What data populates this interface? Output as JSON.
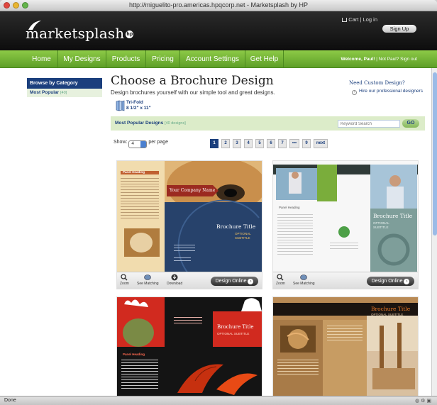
{
  "window": {
    "title": "http://miguelito-pro.americas.hpqcorp.net - Marketsplash by HP"
  },
  "header": {
    "logo_text": "marketsplash",
    "hp_badge": "hp",
    "toplinks": "Cart | Log in",
    "signup_label": "Sign Up"
  },
  "nav": {
    "items": [
      "Home",
      "My Designs",
      "Products",
      "Pricing",
      "Account Settings",
      "Get Help"
    ],
    "welcome": "Welcome, Paul!",
    "not_paul": "Not Paul?",
    "sign_out": "Sign out"
  },
  "sidebar": {
    "heading": "Browse by Category",
    "item_label": "Most Popular",
    "item_count": "[40]"
  },
  "main": {
    "title": "Choose a Brochure Design",
    "subtitle": "Design brochures yourself with our simple tool and great designs.",
    "custom_title": "Need Custom Design?",
    "custom_link": "Hire our professional designers",
    "fold_name": "Tri-Fold",
    "fold_size": "8 1/2\" x 11\""
  },
  "popular": {
    "label": "Most Popular Designs",
    "count": "[40 designs]",
    "search_placeholder": "Keyword Search",
    "go_label": "GO"
  },
  "paging": {
    "show_label": "Show:",
    "per_page_value": "4",
    "per_page_label": "per page",
    "pages": [
      "1",
      "2",
      "3",
      "4",
      "5",
      "6",
      "7",
      "•••",
      "9",
      "next"
    ],
    "active_page": "1"
  },
  "cards": [
    {
      "panel_heading": "Panel Heading",
      "company": "Your Company Name",
      "brochure_title": "Brochure Title",
      "optional": "OPTIONAL",
      "subtitle": "SUBTITLE",
      "zoom": "Zoom",
      "see_matching": "See Matching",
      "download": "Download",
      "design_online": "Design Online"
    },
    {
      "panel_heading": "Panel Heading",
      "brochure_title": "Brochure Title",
      "optional": "OPTIONAL",
      "subtitle": "SUBTITLE",
      "zoom": "Zoom",
      "see_matching": "See Matching",
      "design_online": "Design Online"
    },
    {
      "brochure_title": "Brochure Title",
      "optional": "OPTIONAL SUBTITLE",
      "panel_heading": "Panel Heading"
    },
    {
      "brochure_title": "Brochure Title",
      "optional": "OPTIONAL SUBTITLE"
    }
  ],
  "status": {
    "text": "Done"
  },
  "colors": {
    "nav_green": "#6fb236",
    "brand_blue": "#1b3f7d",
    "header_black": "#111111"
  }
}
